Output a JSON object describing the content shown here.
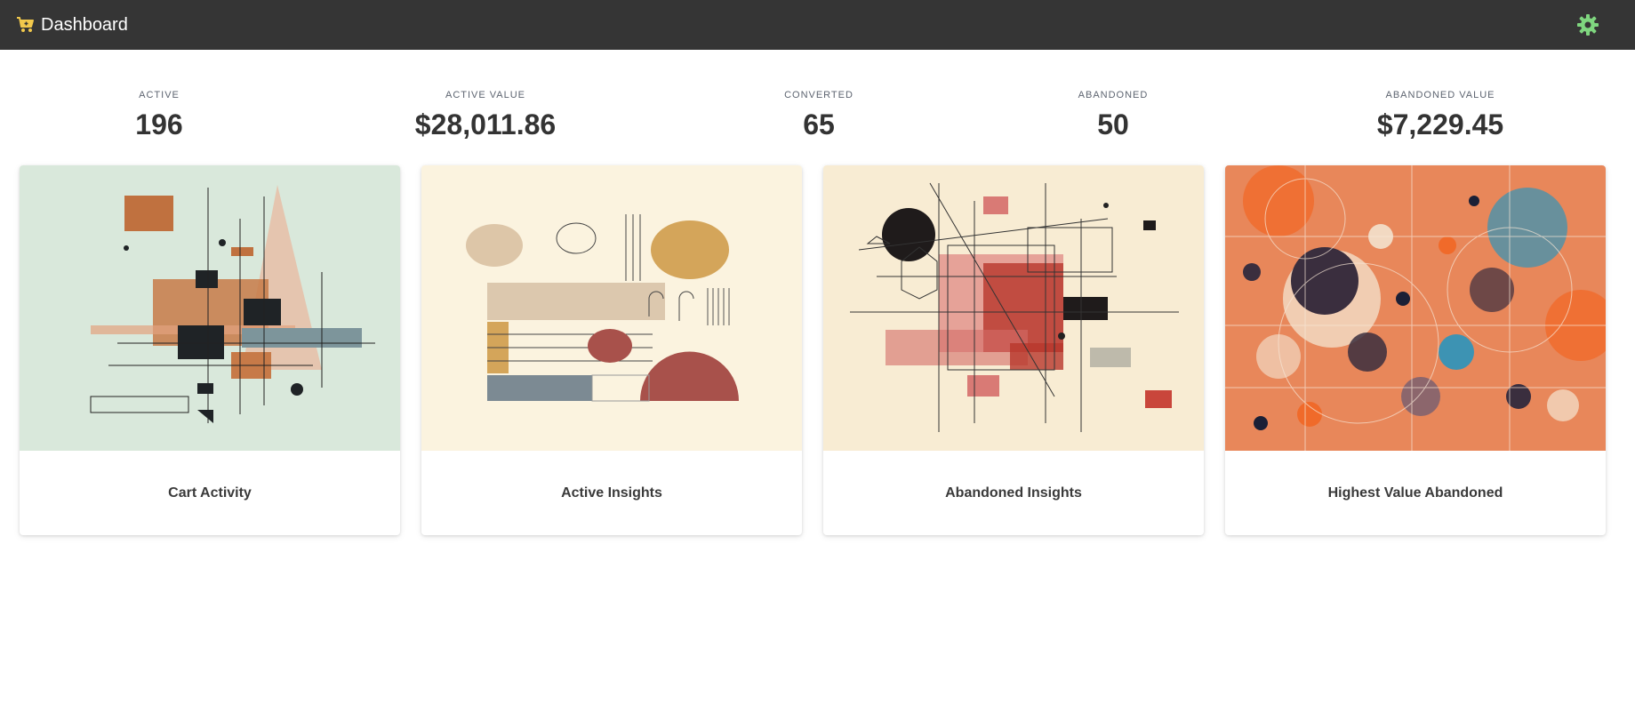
{
  "header": {
    "title": "Dashboard",
    "brand_icon": "shopping-cart-icon",
    "settings_icon": "gear-icon",
    "bar_color": "#353535",
    "cart_color": "#f2c94c",
    "gear_color": "#7fd67f"
  },
  "stats": [
    {
      "label": "ACTIVE",
      "value": "196"
    },
    {
      "label": "ACTIVE VALUE",
      "value": "$28,011.86"
    },
    {
      "label": "CONVERTED",
      "value": "65"
    },
    {
      "label": "ABANDONED",
      "value": "50"
    },
    {
      "label": "ABANDONED VALUE",
      "value": "$7,229.45"
    }
  ],
  "cards": [
    {
      "title": "Cart Activity",
      "art_background": "#d9e8db"
    },
    {
      "title": "Active Insights",
      "art_background": "#fbf3df"
    },
    {
      "title": "Abandoned Insights",
      "art_background": "#f8ecd3"
    },
    {
      "title": "Highest Value Abandoned",
      "art_background": "#e8875a"
    }
  ]
}
